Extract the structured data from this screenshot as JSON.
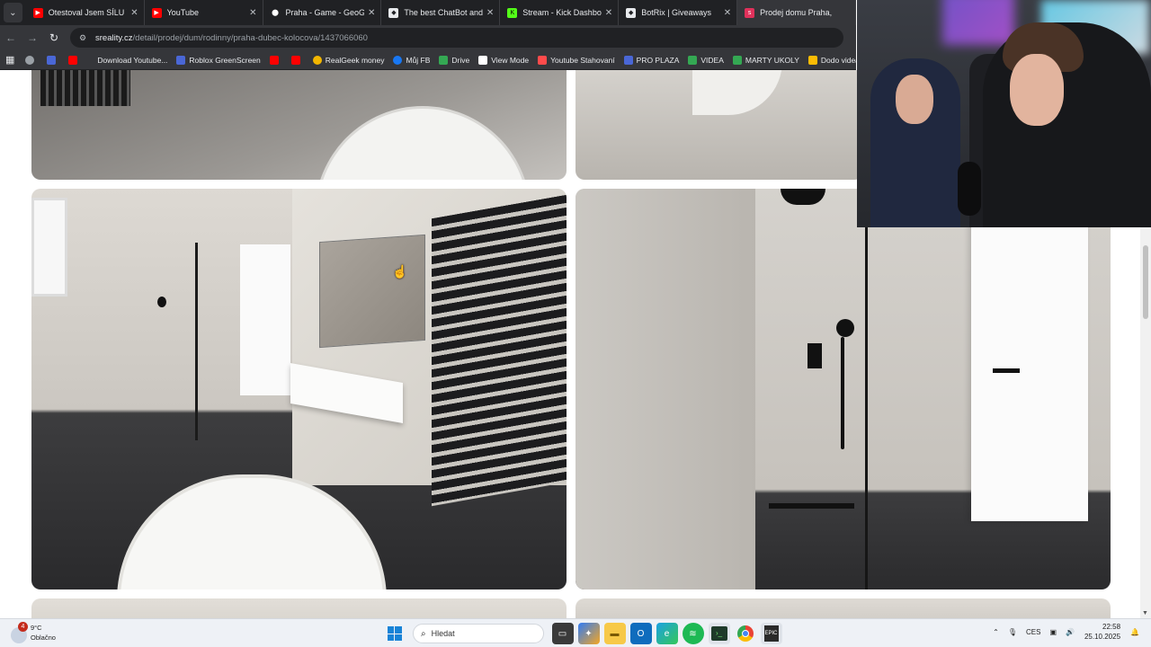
{
  "browser": {
    "tabs": [
      {
        "title": "Otestoval Jsem SÍLU YOU",
        "favicon_color": "#ff0000",
        "icon": "youtube-icon"
      },
      {
        "title": "YouTube",
        "favicon_color": "#ff0000",
        "icon": "youtube-icon"
      },
      {
        "title": "Praha - Game - GeoGuess",
        "favicon_color": "#ffffff",
        "icon": "map-pin-icon"
      },
      {
        "title": "The best ChatBot and Wi",
        "favicon_color": "#ffffff",
        "icon": "shield-icon"
      },
      {
        "title": "Stream - Kick Dashboard",
        "favicon_color": "#53fc18",
        "icon": "kick-icon"
      },
      {
        "title": "BotRix | Giveaways",
        "favicon_color": "#ffffff",
        "icon": "botrix-icon"
      },
      {
        "title": "Prodej domu Praha, ",
        "favicon_color": "#e0315b",
        "icon": "sreality-icon",
        "active": true
      }
    ],
    "url_domain": "sreality.cz",
    "url_path": "/detail/prodej/dum/rodinny/praha-dubec-kolocova/1437066060",
    "bookmarks": [
      {
        "label": "",
        "color": "#9aa0a6"
      },
      {
        "label": "",
        "color": "#4a67d6"
      },
      {
        "label": "",
        "color": "#ff0000"
      },
      {
        "label": "Download Youtube...",
        "color": "#35363a"
      },
      {
        "label": "Roblox GreenScreen",
        "color": "#4a67d6"
      },
      {
        "label": "",
        "color": "#ff0000"
      },
      {
        "label": "",
        "color": "#ff0000"
      },
      {
        "label": "RealGeek money",
        "color": "#f2b600"
      },
      {
        "label": "Můj FB",
        "color": "#1877f2"
      },
      {
        "label": "Drive",
        "color": "#34a853"
      },
      {
        "label": "View Mode",
        "color": "#ffffff"
      },
      {
        "label": "Youtube Stahovaní",
        "color": "#ff4b4b"
      },
      {
        "label": "PRO PLAZA",
        "color": "#4a67d6"
      },
      {
        "label": "VIDEA",
        "color": "#34a853"
      },
      {
        "label": "MARTY UKOLY",
        "color": "#34a853"
      },
      {
        "label": "Dodo videa",
        "color": "#fbbc04"
      },
      {
        "label": "",
        "color": "#34a853"
      }
    ]
  },
  "taskbar": {
    "weather_temp": "9°C",
    "weather_desc": "Oblačno",
    "notification_count": "4",
    "search_placeholder": "Hledat",
    "language": "CES",
    "time": "22:58",
    "date": "25.10.2025",
    "apps": [
      "file-explorer-icon",
      "copilot-icon",
      "folder-icon",
      "outlook-icon",
      "edge-icon",
      "spotify-icon",
      "terminal-icon",
      "chrome-icon",
      "epic-games-icon"
    ]
  }
}
